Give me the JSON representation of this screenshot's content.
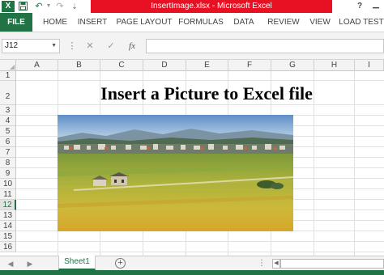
{
  "window": {
    "title": "InsertImage.xlsx -  Microsoft Excel",
    "app_icon_glyph": "X",
    "help_label": "?",
    "minimize_glyph": "🗕",
    "title_red": "#e81123",
    "accent": "#217346"
  },
  "quick_access": {
    "save_icon": "save-icon",
    "undo_icon": "undo-icon",
    "redo_icon": "redo-icon",
    "undo_glyph": "↶",
    "redo_glyph": "↷",
    "save_glyph": "▪",
    "customize_glyph": "⇣"
  },
  "ribbon": {
    "tabs": [
      "FILE",
      "HOME",
      "INSERT",
      "PAGE LAYOUT",
      "FORMULAS",
      "DATA",
      "REVIEW",
      "VIEW",
      "LOAD TEST"
    ]
  },
  "formula_bar": {
    "name_box": "J12",
    "name_box_arrow": "▼",
    "separator_glyph": "⋮",
    "cancel_glyph": "✕",
    "enter_glyph": "✓",
    "fx_label": "fx",
    "formula_value": ""
  },
  "sheet": {
    "columns": [
      "A",
      "B",
      "C",
      "D",
      "E",
      "F",
      "G",
      "H",
      "I"
    ],
    "rows": [
      "1",
      "2",
      "3",
      "4",
      "5",
      "6",
      "7",
      "8",
      "9",
      "10",
      "11",
      "12",
      "13",
      "14",
      "15",
      "16"
    ],
    "active_row": "12",
    "heading": "Insert a Picture to Excel file",
    "picture": "rice-field-landscape-image"
  },
  "sheet_tabs": {
    "tabs": [
      "Sheet1"
    ],
    "prev_glyph": "◀",
    "next_glyph": "▶",
    "add_glyph": "+",
    "dots_glyph": "⋮",
    "scroll_left_glyph": "◀"
  }
}
